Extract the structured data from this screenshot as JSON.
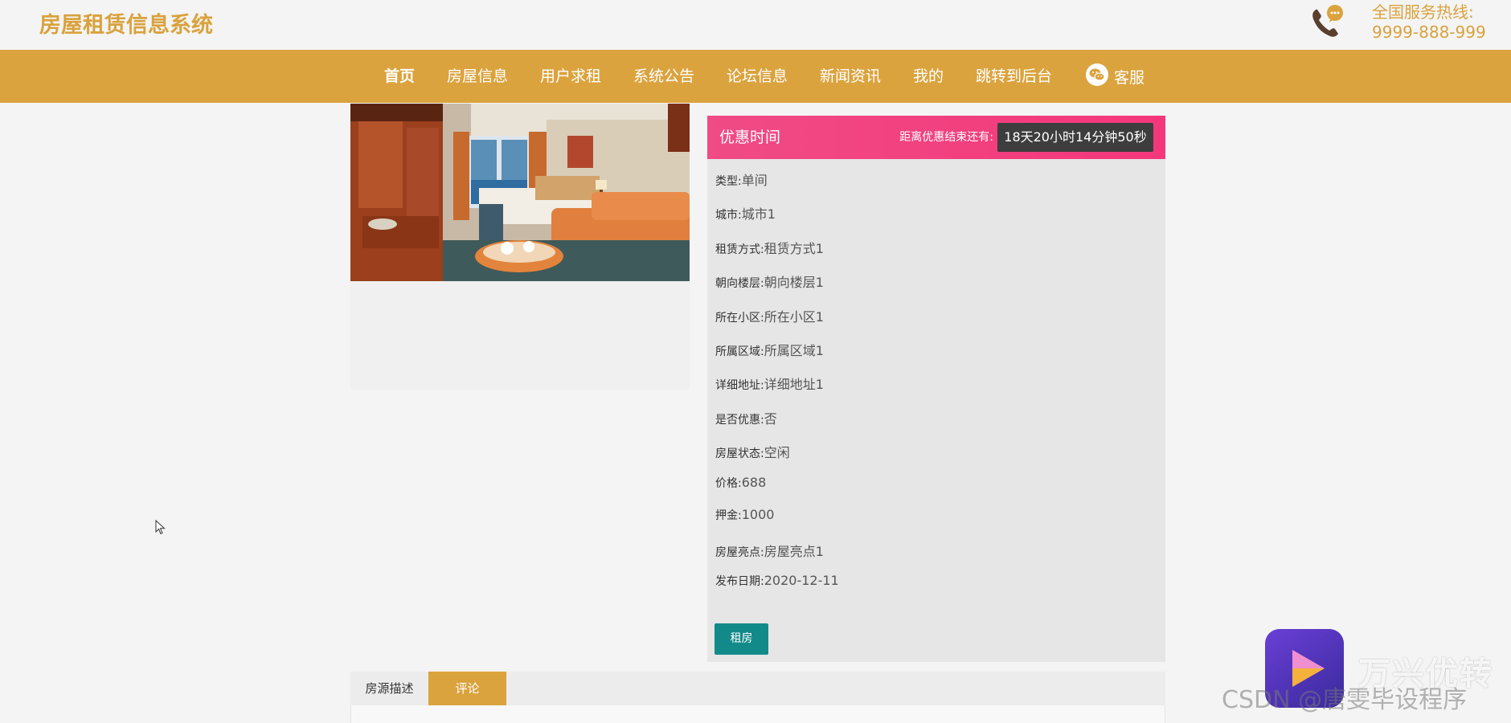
{
  "header": {
    "brand": "房屋租赁信息系统",
    "hotline_label": "全国服务热线:",
    "hotline_number": "9999-888-999",
    "phone_icon": "phone-chat-icon"
  },
  "nav": {
    "items": [
      {
        "label": "首页"
      },
      {
        "label": "房屋信息"
      },
      {
        "label": "用户求租"
      },
      {
        "label": "系统公告"
      },
      {
        "label": "论坛信息"
      },
      {
        "label": "新闻资讯"
      },
      {
        "label": "我的"
      },
      {
        "label": "跳转到后台"
      },
      {
        "label": "客服"
      }
    ],
    "active_index": 0,
    "service_icon": "wechat-icon"
  },
  "promo": {
    "title": "优惠时间",
    "countdown_label": "距离优惠结束还有:",
    "countdown_value": "18天20小时14分钟50秒"
  },
  "details": [
    {
      "label": "类型:",
      "value": "单间"
    },
    {
      "label": "城市:",
      "value": "城市1"
    },
    {
      "label": "租赁方式:",
      "value": "租赁方式1"
    },
    {
      "label": "朝向楼层:",
      "value": "朝向楼层1"
    },
    {
      "label": "所在小区:",
      "value": "所在小区1"
    },
    {
      "label": "所属区域:",
      "value": "所属区域1"
    },
    {
      "label": "详细地址:",
      "value": "详细地址1"
    },
    {
      "label": "是否优惠:",
      "value": "否"
    },
    {
      "label": "房屋状态:",
      "value": "空闲"
    },
    {
      "label": "价格:",
      "value": "688"
    },
    {
      "label": "押金:",
      "value": "1000"
    },
    {
      "label": "房屋亮点:",
      "value": "房屋亮点1"
    },
    {
      "label": "发布日期:",
      "value": "2020-12-11"
    }
  ],
  "rent_button": "租房",
  "tabs": [
    {
      "label": "房源描述"
    },
    {
      "label": "评论"
    }
  ],
  "watermark": {
    "brand": "万兴优转",
    "csdn": "CSDN @唐雯毕设程序"
  },
  "colors": {
    "brand": "#d9a23d",
    "nav": "#dba33e",
    "promo": "#f04b84",
    "button": "#138a8a"
  }
}
